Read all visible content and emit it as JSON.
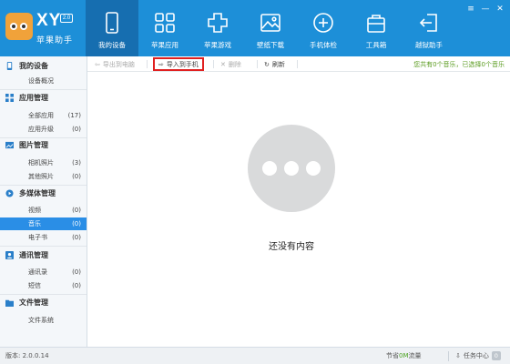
{
  "app": {
    "logo_text": "XY",
    "version_badge": "2.0",
    "name": "苹果助手"
  },
  "nav": [
    {
      "label": "我的设备",
      "icon": "phone-icon"
    },
    {
      "label": "苹果应用",
      "icon": "apps-grid-icon"
    },
    {
      "label": "苹果游戏",
      "icon": "gamepad-cross-icon"
    },
    {
      "label": "壁纸下载",
      "icon": "picture-icon"
    },
    {
      "label": "手机体检",
      "icon": "health-check-icon"
    },
    {
      "label": "工具箱",
      "icon": "toolbox-icon"
    },
    {
      "label": "越狱助手",
      "icon": "exit-arrow-icon"
    }
  ],
  "window_controls": {
    "menu": "≡",
    "minimize": "—",
    "close": "✕"
  },
  "sidebar": {
    "device": {
      "title": "我的设备",
      "items": [
        {
          "label": "设备概况",
          "count": ""
        }
      ]
    },
    "apps": {
      "title": "应用管理",
      "items": [
        {
          "label": "全部应用",
          "count": "(17)"
        },
        {
          "label": "应用升级",
          "count": "(0)"
        }
      ]
    },
    "photos": {
      "title": "图片管理",
      "items": [
        {
          "label": "相机照片",
          "count": "(3)"
        },
        {
          "label": "其他照片",
          "count": "(0)"
        }
      ]
    },
    "media": {
      "title": "多媒体管理",
      "items": [
        {
          "label": "视频",
          "count": "(0)"
        },
        {
          "label": "音乐",
          "count": "(0)"
        },
        {
          "label": "电子书",
          "count": "(0)"
        }
      ]
    },
    "comm": {
      "title": "通讯管理",
      "items": [
        {
          "label": "通讯录",
          "count": "(0)"
        },
        {
          "label": "短信",
          "count": "(0)"
        }
      ]
    },
    "files": {
      "title": "文件管理",
      "items": [
        {
          "label": "文件系统",
          "count": ""
        }
      ]
    }
  },
  "toolbar": {
    "export_label": "导出到电脑",
    "import_label": "导入到手机",
    "delete_label": "删除",
    "refresh_label": "刷新",
    "info": "您共有0个音乐，已选择0个音乐"
  },
  "empty": {
    "text": "还没有内容"
  },
  "status": {
    "version": "版本: 2.0.0.14",
    "traffic_prefix": "节省",
    "traffic_value": "0M",
    "traffic_suffix": "流量",
    "task_label": "任务中心",
    "task_count": "0"
  },
  "colors": {
    "header": "#1d8fd8",
    "active_nav": "#166eb0",
    "selected_item": "#2a8ee6",
    "highlight_border": "#e02020",
    "green_text": "#5a9b1f"
  }
}
